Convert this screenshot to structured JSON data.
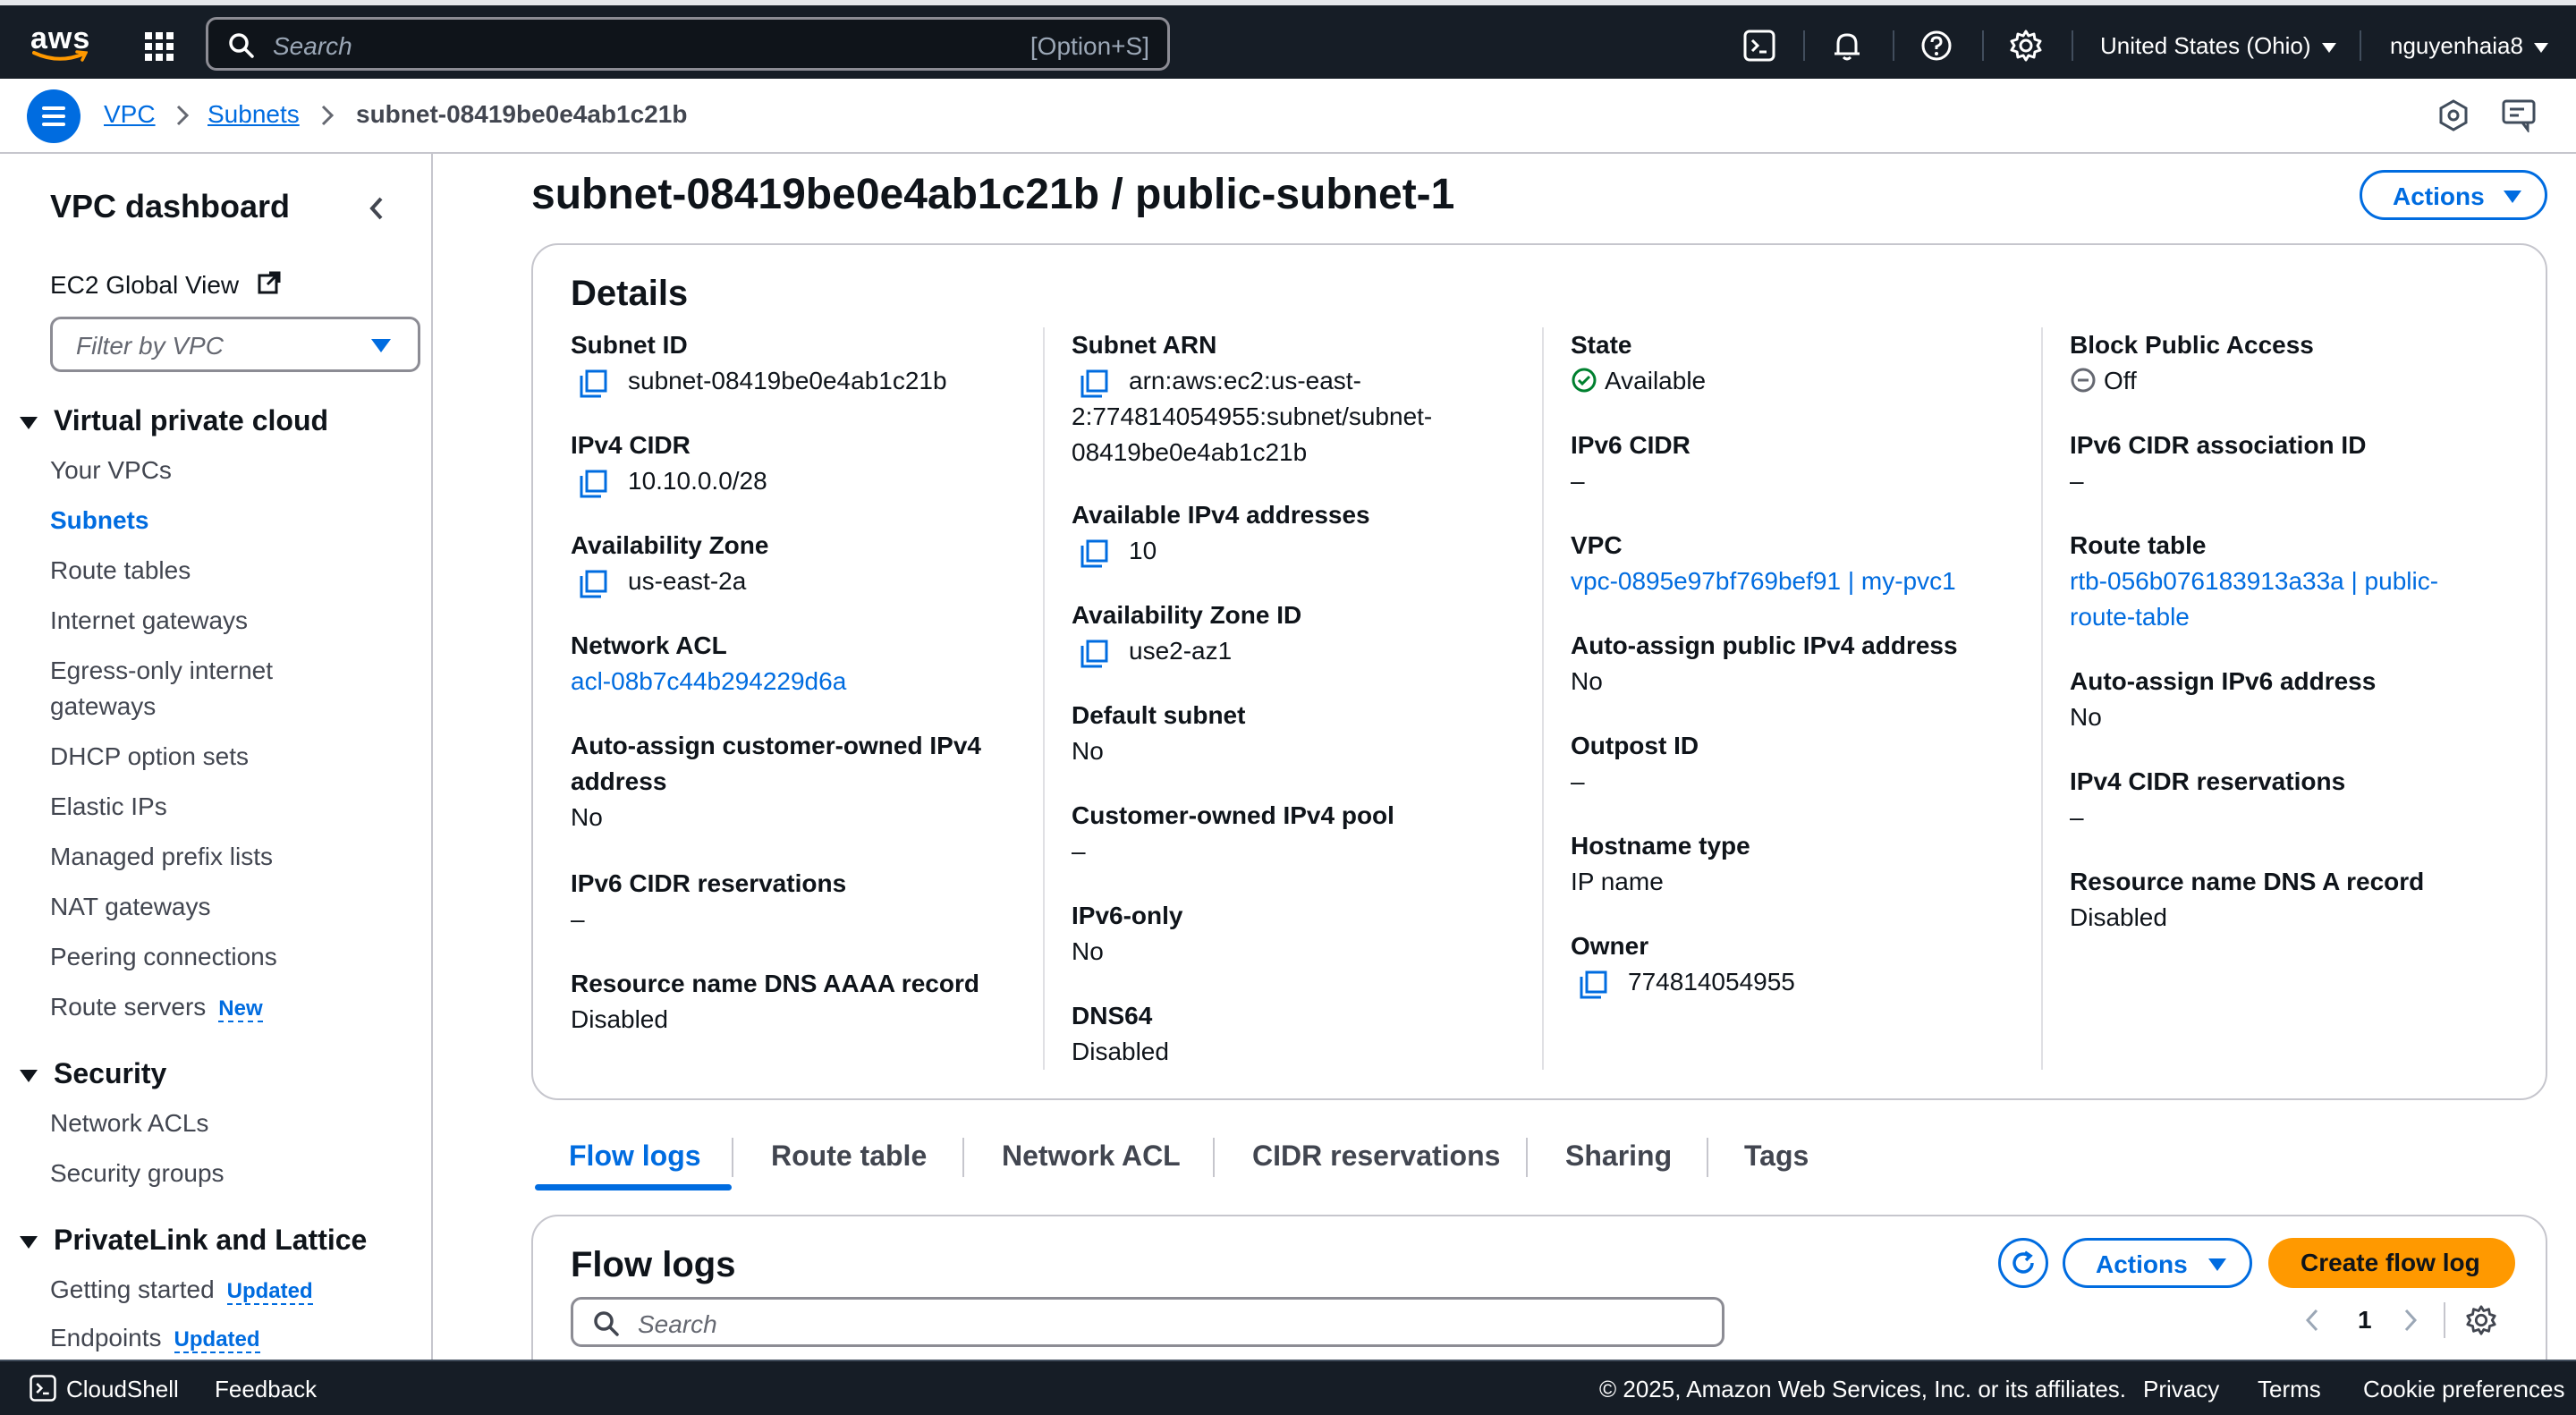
{
  "topbar": {
    "logo_text": "aws",
    "search_placeholder": "Search",
    "search_shortcut": "[Option+S]",
    "region": "United States (Ohio)",
    "user": "nguyenhaia8",
    "icons": [
      "cloudshell-icon",
      "bell-icon",
      "help-icon",
      "gear-icon"
    ]
  },
  "breadcrumb": {
    "items": [
      "VPC",
      "Subnets"
    ],
    "current": "subnet-08419be0e4ab1c21b"
  },
  "sidebar": {
    "title": "VPC dashboard",
    "ec2_global_view": "EC2 Global View",
    "filter_placeholder": "Filter by VPC",
    "sections": [
      {
        "title": "Virtual private cloud",
        "items": [
          "Your VPCs",
          "Subnets",
          "Route tables",
          "Internet gateways",
          "Egress-only internet",
          "gateways",
          "DHCP option sets",
          "Elastic IPs",
          "Managed prefix lists",
          "NAT gateways",
          "Peering connections",
          "Route servers"
        ]
      },
      {
        "title": "Security",
        "items": [
          "Network ACLs",
          "Security groups"
        ]
      },
      {
        "title": "PrivateLink and Lattice",
        "items": [
          "Getting started",
          "Endpoints"
        ]
      }
    ],
    "badges": {
      "route_servers": "New",
      "getting_started": "Updated",
      "endpoints": "Updated"
    },
    "active_item": "Subnets"
  },
  "page": {
    "title": "subnet-08419be0e4ab1c21b / public-subnet-1",
    "actions_label": "Actions"
  },
  "details": {
    "title": "Details",
    "col1": {
      "subnet_id_k": "Subnet ID",
      "subnet_id_v": "subnet-08419be0e4ab1c21b",
      "ipv4_cidr_k": "IPv4 CIDR",
      "ipv4_cidr_v": "10.10.0.0/28",
      "az_k": "Availability Zone",
      "az_v": "us-east-2a",
      "nacl_k": "Network ACL",
      "nacl_v": "acl-08b7c44b294229d6a",
      "auto_cust_k1": "Auto-assign customer-owned IPv4",
      "auto_cust_k2": "address",
      "auto_cust_v": "No",
      "ipv6_res_k": "IPv6 CIDR reservations",
      "ipv6_res_v": "–",
      "dns_aaaa_k": "Resource name DNS AAAA record",
      "dns_aaaa_v": "Disabled"
    },
    "col2": {
      "arn_k": "Subnet ARN",
      "arn_v1": "arn:aws:ec2:us-east-",
      "arn_v2": "2:774814054955:subnet/subnet-",
      "arn_v3": "08419be0e4ab1c21b",
      "avail_k": "Available IPv4 addresses",
      "avail_v": "10",
      "azid_k": "Availability Zone ID",
      "azid_v": "use2-az1",
      "default_k": "Default subnet",
      "default_v": "No",
      "cust_pool_k": "Customer-owned IPv4 pool",
      "cust_pool_v": "–",
      "ipv6only_k": "IPv6-only",
      "ipv6only_v": "No",
      "dns64_k": "DNS64",
      "dns64_v": "Disabled"
    },
    "col3": {
      "state_k": "State",
      "state_v": "Available",
      "ipv6cidr_k": "IPv6 CIDR",
      "ipv6cidr_v": "–",
      "vpc_k": "VPC",
      "vpc_v": "vpc-0895e97bf769bef91 | my-pvc1",
      "autopub_k": "Auto-assign public IPv4 address",
      "autopub_v": "No",
      "outpost_k": "Outpost ID",
      "outpost_v": "–",
      "hostname_k": "Hostname type",
      "hostname_v": "IP name",
      "owner_k": "Owner",
      "owner_v": "774814054955"
    },
    "col4": {
      "bpa_k": "Block Public Access",
      "bpa_v": "Off",
      "ipv6assoc_k": "IPv6 CIDR association ID",
      "ipv6assoc_v": "–",
      "rt_k": "Route table",
      "rt_v1": "rtb-056b076183913a33a | public-",
      "rt_v2": "route-table",
      "autoipv6_k": "Auto-assign IPv6 address",
      "autoipv6_v": "No",
      "ipv4res_k": "IPv4 CIDR reservations",
      "ipv4res_v": "–",
      "dnsa_k": "Resource name DNS A record",
      "dnsa_v": "Disabled"
    }
  },
  "tabs": [
    "Flow logs",
    "Route table",
    "Network ACL",
    "CIDR reservations",
    "Sharing",
    "Tags"
  ],
  "active_tab": "Flow logs",
  "flowlogs": {
    "title": "Flow logs",
    "actions_label": "Actions",
    "create_label": "Create flow log",
    "search_placeholder": "Search",
    "page": "1"
  },
  "footer": {
    "cloudshell": "CloudShell",
    "feedback": "Feedback",
    "copyright": "© 2025, Amazon Web Services, Inc. or its affiliates.",
    "privacy": "Privacy",
    "terms": "Terms",
    "cookies": "Cookie preferences"
  },
  "colors": {
    "accent": "#006ce0",
    "primary_button": "#ff9900",
    "success": "#00802f",
    "topbar": "#161d26"
  }
}
